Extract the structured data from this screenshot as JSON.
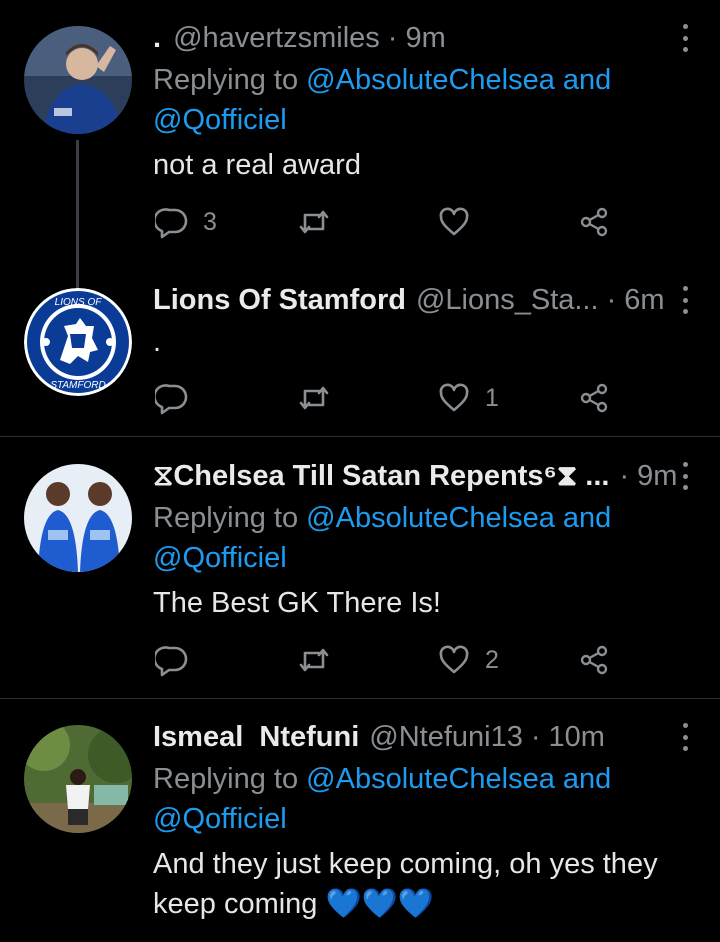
{
  "tweets": [
    {
      "prefix": ".",
      "handle": "@havertzsmiles",
      "sep": "·",
      "time": "9m",
      "replying_prefix": "Replying to",
      "replying_to1": "@AbsoluteChelsea",
      "replying_and": "and",
      "replying_to2": "@Qofficiel",
      "text": "not a real award",
      "reply_count": "3",
      "retweet_count": "",
      "like_count": ""
    },
    {
      "name": "Lions Of Stamford",
      "handle": "@Lions_Sta...",
      "sep": "·",
      "time": "6m",
      "text": ".",
      "reply_count": "",
      "retweet_count": "",
      "like_count": "1",
      "avatar_text_top": "LIONS OF",
      "avatar_text_bottom": "STAMFORD"
    },
    {
      "name": "⧖Chelsea Till Satan Repents⁶⧗ ...",
      "sep": "·",
      "time": "9m",
      "replying_prefix": "Replying to",
      "replying_to1": "@AbsoluteChelsea",
      "replying_and": "and",
      "replying_to2": "@Qofficiel",
      "text": "The Best GK There Is!",
      "reply_count": "",
      "retweet_count": "",
      "like_count": "2"
    },
    {
      "name": "Ismeal  Ntefuni",
      "handle": "@Ntefuni13",
      "sep": "·",
      "time": "10m",
      "replying_prefix": "Replying to",
      "replying_to1": "@AbsoluteChelsea",
      "replying_and": "and",
      "replying_to2": "@Qofficiel",
      "text_line1": "And they just keep coming, oh yes they",
      "text_line2": "keep coming",
      "emoji": "💙💙💙"
    }
  ],
  "colors": {
    "accent": "#1d9bf0",
    "muted": "#8a8f94",
    "background": "#000000"
  },
  "icons": [
    "reply-icon",
    "retweet-icon",
    "like-icon",
    "share-icon",
    "more-icon"
  ]
}
